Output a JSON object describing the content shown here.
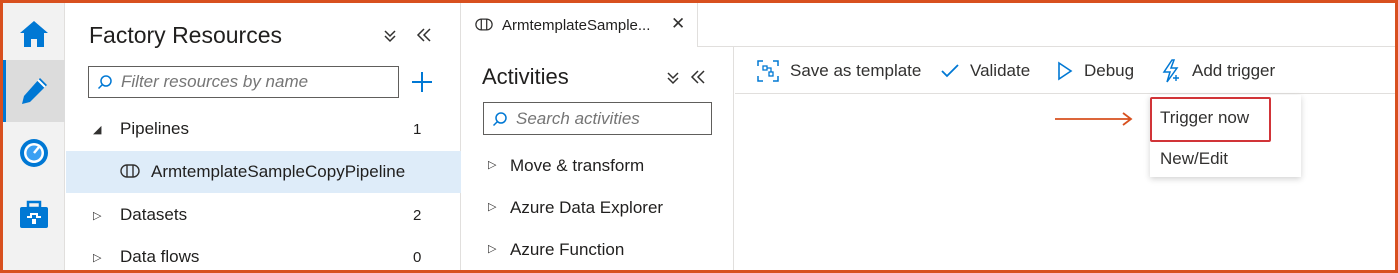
{
  "rail": {
    "items": [
      {
        "icon": "home-icon"
      },
      {
        "icon": "pencil-icon",
        "active": true
      },
      {
        "icon": "monitor-gauge-icon"
      },
      {
        "icon": "toolbox-icon"
      }
    ]
  },
  "resources": {
    "title": "Factory Resources",
    "filter_placeholder": "Filter resources by name",
    "tree": [
      {
        "label": "Pipelines",
        "count": "1",
        "expanded": true
      },
      {
        "label": "ArmtemplateSampleCopyPipeline",
        "selected": true
      },
      {
        "label": "Datasets",
        "count": "2",
        "expanded": false
      },
      {
        "label": "Data flows",
        "count": "0",
        "expanded": false
      }
    ]
  },
  "tab": {
    "label": "ArmtemplateSample...",
    "close": "✕"
  },
  "activities": {
    "title": "Activities",
    "search_placeholder": "Search activities",
    "groups": [
      {
        "label": "Move & transform"
      },
      {
        "label": "Azure Data Explorer"
      },
      {
        "label": "Azure Function"
      }
    ]
  },
  "toolbar": {
    "save_template": "Save as template",
    "validate": "Validate",
    "debug": "Debug",
    "add_trigger": "Add trigger"
  },
  "trigger_menu": {
    "items": [
      {
        "label": "Trigger now",
        "highlighted": true
      },
      {
        "label": "New/Edit"
      }
    ]
  },
  "colors": {
    "accent": "#0078d4",
    "frame_border": "#d8501f",
    "highlight_box": "#d13438",
    "selected_row": "#deecf9"
  }
}
